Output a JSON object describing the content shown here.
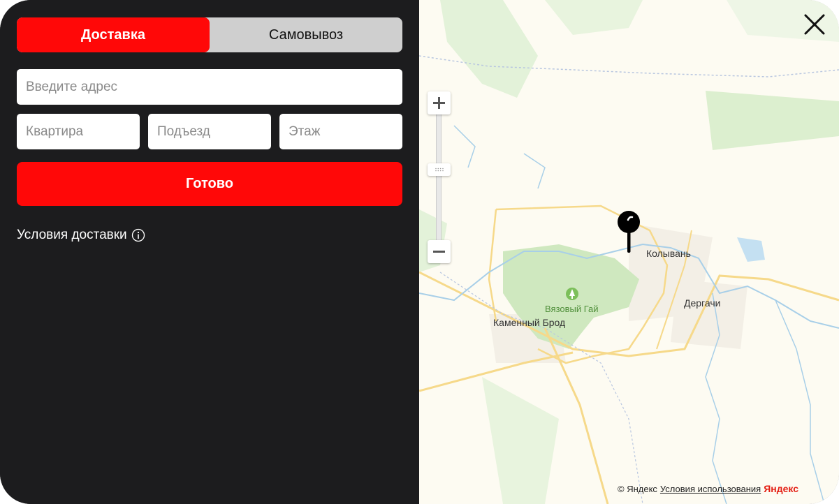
{
  "tabs": {
    "delivery": "Доставка",
    "pickup": "Самовывоз"
  },
  "fields": {
    "address_placeholder": "Введите адрес",
    "apartment_placeholder": "Квартира",
    "entrance_placeholder": "Подъезд",
    "floor_placeholder": "Этаж"
  },
  "done_label": "Готово",
  "delivery_terms": "Условия доставки",
  "map": {
    "labels": {
      "kolyvan": "Колывань",
      "dergachi": "Дергачи",
      "park": "Вязовый Гай",
      "kamenny_brod": "Каменный Брод"
    },
    "zoom_plus": "+",
    "zoom_minus": "−",
    "copyright": "© Яндекс",
    "terms_link": "Условия использования",
    "logo": "Яндекс"
  },
  "colors": {
    "accent": "#ff0808",
    "panel": "#1c1c1e"
  },
  "icons": {
    "close": "close-icon",
    "info": "info-icon",
    "pin": "map-pin-icon"
  }
}
